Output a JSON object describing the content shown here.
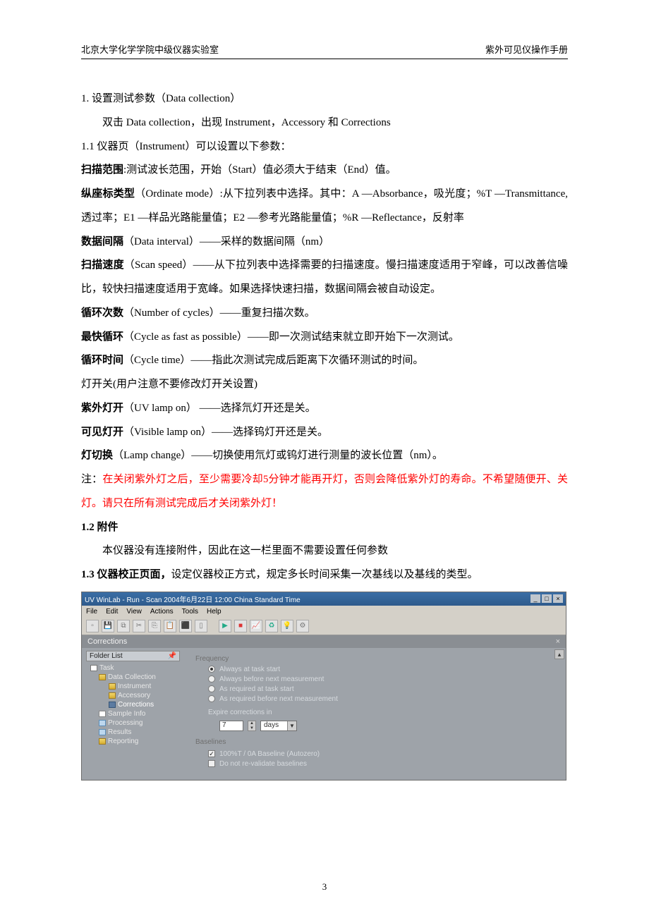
{
  "header": {
    "left": "北京大学化学学院中级仪器实验室",
    "right": "紫外可见仪操作手册"
  },
  "page_number": "3",
  "sections": {
    "s1_title": "1. 设置测试参数（Data collection）",
    "s1_intro": "双击 Data collection，出现 Instrument，Accessory 和 Corrections",
    "s11_title": "1.1 仪器页（Instrument）可以设置以下参数：",
    "p_scan_range_label": "扫描范围",
    "p_scan_range_text": ":测试波长范围，开始（Start）值必须大于结束（End）值。",
    "p_ord_label": "纵座标类型",
    "p_ord_text": "（Ordinate mode）:从下拉列表中选择。其中：A —Absorbance，吸光度；%T —Transmittance,透过率；E1 —样品光路能量值；E2 —参考光路能量值；%R —Reflectance，反射率",
    "p_interval_label": "数据间隔",
    "p_interval_text": "（Data interval）——采样的数据间隔（nm）",
    "p_speed_label": "扫描速度",
    "p_speed_text": "（Scan speed）——从下拉列表中选择需要的扫描速度。慢扫描速度适用于窄峰，可以改善信噪比，较快扫描速度适用于宽峰。如果选择快速扫描，数据间隔会被自动设定。",
    "p_cycles_label": "循环次数",
    "p_cycles_text": "（Number of cycles）——重复扫描次数。",
    "p_fast_label": "最快循环",
    "p_fast_text": "（Cycle as fast as possible）——即一次测试结束就立即开始下一次测试。",
    "p_ctime_label": "循环时间",
    "p_ctime_text": "（Cycle time）——指此次测试完成后距离下次循环测试的时间。",
    "p_lamp_switch": "灯开关(用户注意不要修改灯开关设置)",
    "p_uv_label": "紫外灯开",
    "p_uv_text": "（UV lamp on） ——选择氘灯开还是关。",
    "p_vis_label": "可见灯开",
    "p_vis_text": "（Visible lamp on）——选择钨灯开还是关。",
    "p_change_label": "灯切换",
    "p_change_text": "（Lamp change）——切换使用氘灯或钨灯进行测量的波长位置（nm）。",
    "p_note_label": "注：",
    "p_note_text": "在关闭紫外灯之后，至少需要冷却5分钟才能再开灯，否则会降低紫外灯的寿命。不希望随便开、关灯。请只在所有测试完成后才关闭紫外灯！",
    "s12_title": "1.2 附件",
    "s12_text": "本仪器没有连接附件，因此在这一栏里面不需要设置任何参数",
    "s13_title_bold": "1.3 仪器校正页面，",
    "s13_title_rest": "设定仪器校正方式，规定多长时间采集一次基线以及基线的类型。"
  },
  "screenshot": {
    "window_title": "UV WinLab - Run - Scan 2004年6月22日 12:00 China Standard Time",
    "winctrls": {
      "min": "_",
      "max": "□",
      "close": "×"
    },
    "menubar": [
      "File",
      "Edit",
      "View",
      "Actions",
      "Tools",
      "Help"
    ],
    "panel_title": "Corrections",
    "panel_close": "×",
    "sidebar_header": "Folder List",
    "sidebar_pin": "📌",
    "tree": {
      "root": "Task",
      "data_collection": "Data Collection",
      "instrument": "Instrument",
      "accessory": "Accessory",
      "corrections": "Corrections",
      "sample_info": "Sample Info",
      "processing": "Processing",
      "results": "Results",
      "reporting": "Reporting"
    },
    "main": {
      "group_frequency": "Frequency",
      "opt1": "Always at task start",
      "opt2": "Always before next measurement",
      "opt3": "As required at task start",
      "opt4": "As required before next measurement",
      "expire_label": "Expire corrections in",
      "expire_value": "7",
      "expire_unit": "days",
      "group_baselines": "Baselines",
      "chk1": "100%T / 0A Baseline (Autozero)",
      "chk2": "Do not re-validate baselines"
    }
  }
}
